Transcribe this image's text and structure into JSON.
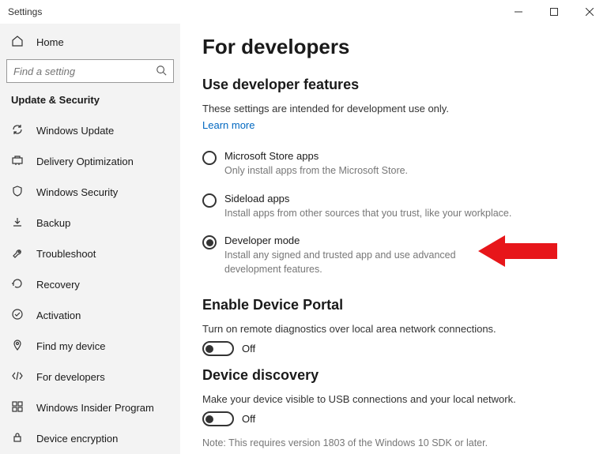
{
  "window": {
    "title": "Settings"
  },
  "sidebar": {
    "home": "Home",
    "search_placeholder": "Find a setting",
    "heading": "Update & Security",
    "items": [
      {
        "label": "Windows Update"
      },
      {
        "label": "Delivery Optimization"
      },
      {
        "label": "Windows Security"
      },
      {
        "label": "Backup"
      },
      {
        "label": "Troubleshoot"
      },
      {
        "label": "Recovery"
      },
      {
        "label": "Activation"
      },
      {
        "label": "Find my device"
      },
      {
        "label": "For developers"
      },
      {
        "label": "Windows Insider Program"
      },
      {
        "label": "Device encryption"
      }
    ]
  },
  "main": {
    "title": "For developers",
    "features": {
      "heading": "Use developer features",
      "intro": "These settings are intended for development use only.",
      "learn_more": "Learn more",
      "options": [
        {
          "label": "Microsoft Store apps",
          "desc": "Only install apps from the Microsoft Store."
        },
        {
          "label": "Sideload apps",
          "desc": "Install apps from other sources that you trust, like your workplace."
        },
        {
          "label": "Developer mode",
          "desc": "Install any signed and trusted app and use advanced development features."
        }
      ],
      "selected_index": 2
    },
    "device_portal": {
      "heading": "Enable Device Portal",
      "desc": "Turn on remote diagnostics over local area network connections.",
      "toggle_label": "Off"
    },
    "device_discovery": {
      "heading": "Device discovery",
      "desc": "Make your device visible to USB connections and your local network.",
      "toggle_label": "Off",
      "note": "Note: This requires version 1803 of the Windows 10 SDK or later."
    }
  }
}
